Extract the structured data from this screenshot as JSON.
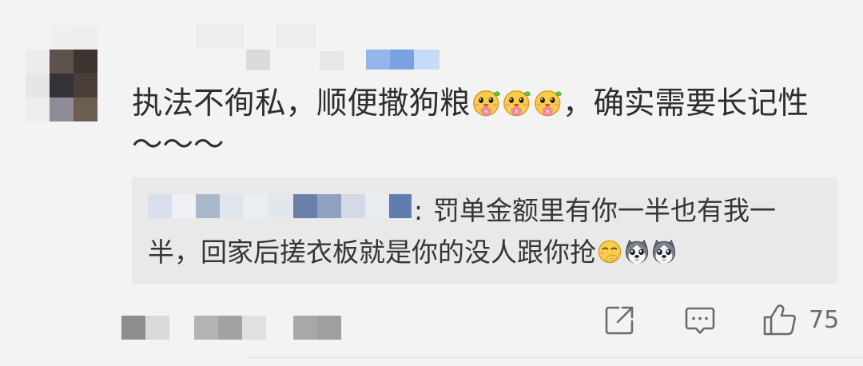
{
  "colors": {
    "background": "#f3f3f3",
    "reply_background": "#e9e9e9",
    "text": "#2e2e2e",
    "reply_text": "#353535",
    "icon": "#6b6b6b"
  },
  "comment": {
    "text_before_emojis": "执法不徇私，顺便撒狗粮",
    "emojis": [
      "flower-face-emoji",
      "flower-face-emoji",
      "flower-face-emoji"
    ],
    "text_after_emojis": "，确实需要长记性",
    "text_tail": "～～～"
  },
  "reply": {
    "name_separator": ":",
    "text_line1": "罚单金额里有你一半也有我一",
    "text_line2": "半，回家后搓衣板就是你的没人跟你抢",
    "emojis": [
      "cover-mouth-emoji",
      "husky-emoji",
      "husky-emoji"
    ]
  },
  "actions": {
    "share_icon": "share-icon",
    "comment_icon": "comment-icon",
    "like_icon": "thumbs-up-icon",
    "like_count": "75"
  }
}
